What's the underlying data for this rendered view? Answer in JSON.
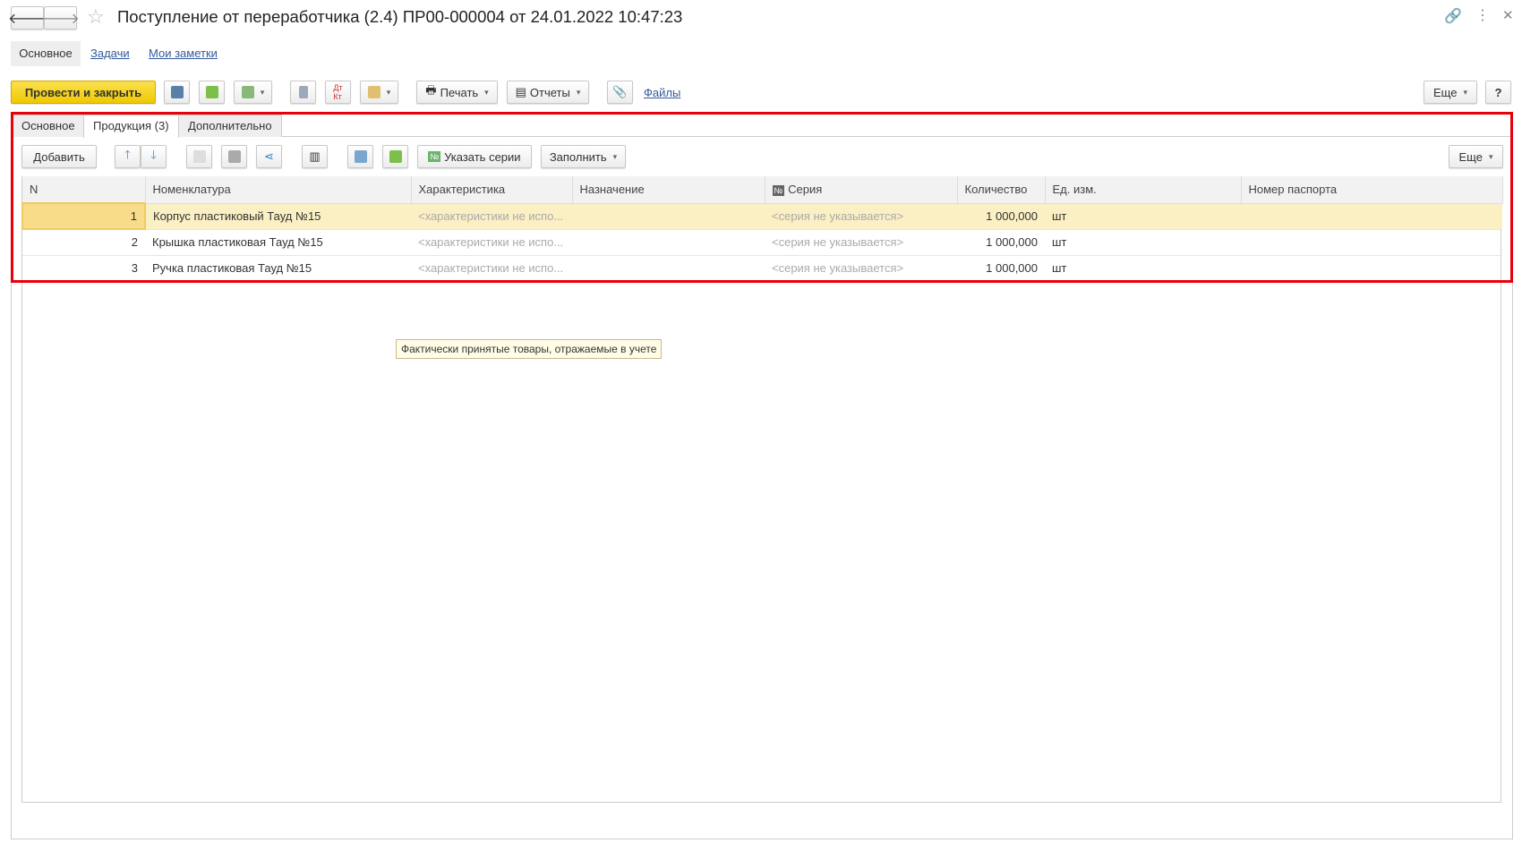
{
  "window": {
    "title": "Поступление от переработчика (2.4) ПР00-000004 от 24.01.2022 10:47:23"
  },
  "nav_tabs": [
    {
      "label": "Основное"
    },
    {
      "label": "Задачи"
    },
    {
      "label": "Мои заметки"
    }
  ],
  "toolbar": {
    "post_close": "Провести и закрыть",
    "print": "Печать",
    "reports": "Отчеты",
    "files": "Файлы",
    "more": "Еще",
    "help": "?"
  },
  "form_tabs": [
    {
      "label": "Основное"
    },
    {
      "label": "Продукция (3)"
    },
    {
      "label": "Дополнительно"
    }
  ],
  "table_toolbar": {
    "add": "Добавить",
    "set_series": "Указать серии",
    "fill": "Заполнить",
    "more": "Еще",
    "series_badge": "№"
  },
  "table": {
    "columns": [
      "N",
      "Номенклатура",
      "Характеристика",
      "Назначение",
      "Серия",
      "Количество",
      "Ед. изм.",
      "Номер паспорта"
    ],
    "rows": [
      {
        "n": "1",
        "item": "Корпус пластиковый Тауд №15",
        "char": "<характеристики не испо...",
        "purpose": "",
        "series": "<серия не указывается>",
        "qty": "1 000,000",
        "unit": "шт",
        "passport": ""
      },
      {
        "n": "2",
        "item": "Крышка пластиковая Тауд №15",
        "char": "<характеристики не испо...",
        "purpose": "",
        "series": "<серия не указывается>",
        "qty": "1 000,000",
        "unit": "шт",
        "passport": ""
      },
      {
        "n": "3",
        "item": "Ручка пластиковая Тауд №15",
        "char": "<характеристики не испо...",
        "purpose": "",
        "series": "<серия не указывается>",
        "qty": "1 000,000",
        "unit": "шт",
        "passport": ""
      }
    ]
  },
  "tooltip": "Фактически принятые товары, отражаемые в учете",
  "colors": {
    "accent": "#f5d22e",
    "highlight": "#e8000b",
    "selected_row": "#fbefc4"
  }
}
